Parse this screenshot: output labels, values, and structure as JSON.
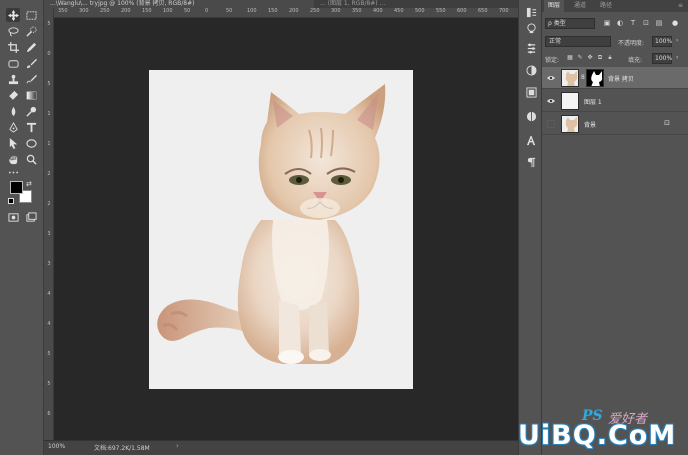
{
  "document": {
    "active_tab": "...\\Wanglu\\... tryjpg @ 100% (背景 拷贝, RGB/8#)",
    "second_tab": "... (图层 1, RGB/8#) ...",
    "zoom": "100%",
    "doc_info": "文档:697.2K/1.58M",
    "background_color": "#efefef"
  },
  "rulers": {
    "h_labels": [
      "350",
      "300",
      "250",
      "200",
      "150",
      "100",
      "50",
      "0",
      "50",
      "100",
      "150",
      "200",
      "250",
      "300",
      "350",
      "400",
      "450",
      "500",
      "550",
      "600",
      "650",
      "700"
    ],
    "v_labels": [
      "5",
      "0",
      "5",
      "1",
      "1",
      "2",
      "2",
      "3",
      "3",
      "4",
      "4",
      "5",
      "5",
      "6"
    ]
  },
  "toolbar": {
    "tools": [
      "move-tool",
      "marquee-tool",
      "lasso-tool",
      "quick-select-tool",
      "crop-tool",
      "eyedropper-tool",
      "frame-tool",
      "brush-tool",
      "stamp-tool",
      "history-brush-tool",
      "eraser-tool",
      "gradient-tool",
      "blur-tool",
      "dodge-tool",
      "pen-tool",
      "type-tool",
      "path-select-tool",
      "ellipse-tool",
      "hand-tool",
      "zoom-tool",
      "more-tools"
    ],
    "foreground": "#000000",
    "background": "#ffffff"
  },
  "layers_panel": {
    "tabs": [
      "图层",
      "通道",
      "路径"
    ],
    "active_tab": "图层",
    "filter_label": "ρ 类型",
    "filter_icons": [
      "image-filter",
      "adjustment-filter",
      "type-filter",
      "shape-filter",
      "smartobject-filter"
    ],
    "blend_mode": "正常",
    "opacity_label": "不透明度:",
    "opacity": "100%",
    "lock_label": "锁定:",
    "fill_label": "填充:",
    "fill": "100%",
    "layers": [
      {
        "name": "背景 拷贝",
        "visible": true,
        "selected": true,
        "thumb": "cat",
        "has_mask": true,
        "locked": false
      },
      {
        "name": "图层 1",
        "visible": true,
        "selected": false,
        "thumb": "white",
        "has_mask": false,
        "locked": false
      },
      {
        "name": "背景",
        "visible": false,
        "selected": false,
        "thumb": "cat",
        "has_mask": false,
        "locked": true
      }
    ]
  },
  "watermark": {
    "ps": "PS",
    "ps_cn": "爱好者",
    "url": "UiBQ.CoM"
  },
  "colors": {
    "panel": "#535353",
    "canvas": "#282828",
    "selected_layer": "#6a6a6a",
    "watermark_blue": "#2fa9e0"
  }
}
